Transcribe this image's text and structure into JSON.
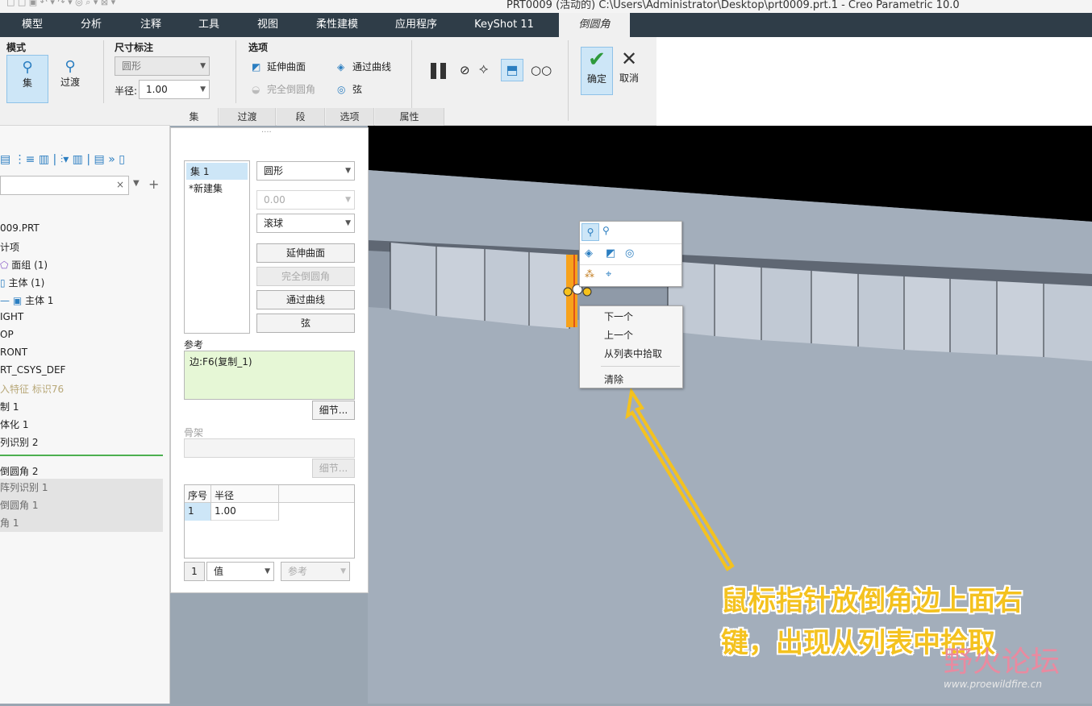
{
  "window": {
    "title": "PRT0009 (活动的) C:\\Users\\Administrator\\Desktop\\prt0009.prt.1 - Creo Parametric 10.0"
  },
  "tabs": [
    "模型",
    "分析",
    "注释",
    "工具",
    "视图",
    "柔性建模",
    "应用程序",
    "KeyShot 11",
    "倒圆角"
  ],
  "ribbon": {
    "mode": {
      "label": "模式",
      "set_label": "集",
      "transition_label": "过渡"
    },
    "dimension": {
      "label": "尺寸标注",
      "shape_value": "圆形",
      "radius_label": "半径:",
      "radius_value": "1.00"
    },
    "options": {
      "label": "选项",
      "extend_surface": "延伸曲面",
      "full_round": "完全倒圆角",
      "through_curve": "通过曲线",
      "chord": "弦"
    },
    "ok_label": "确定",
    "cancel_label": "取消"
  },
  "subtabs": [
    "集",
    "过渡",
    "段",
    "选项",
    "属性"
  ],
  "tree": {
    "rows": [
      "009.PRT",
      "计项",
      "面组 (1)",
      "主体 (1)",
      "主体 1",
      "IGHT",
      "OP",
      "RONT",
      "RT_CSYS_DEF",
      "入特征 标识76",
      "制 1",
      "体化 1",
      "列识别 2",
      "倒圆角 2",
      "阵列识别 1",
      "倒圆角 1",
      "角 1"
    ]
  },
  "panel": {
    "sets": [
      "集 1",
      "*新建集"
    ],
    "shape": "圆形",
    "value": "0.00",
    "method": "滚球",
    "btn_extend": "延伸曲面",
    "btn_full": "完全倒圆角",
    "btn_curve": "通过曲线",
    "btn_chord": "弦",
    "ref_label": "参考",
    "ref_value": "边:F6(复制_1)",
    "details": "细节...",
    "skeleton_label": "骨架",
    "skeleton_details": "细节...",
    "table_headers": [
      "序号",
      "半径"
    ],
    "table_row": [
      "1",
      "1.00"
    ],
    "bottom_num": "1",
    "bottom_value": "值",
    "bottom_ref": "参考",
    "grip": "····"
  },
  "context_menu": {
    "items": [
      "下一个",
      "上一个",
      "从列表中拾取",
      "清除"
    ]
  },
  "annotation": {
    "line1": "鼠标指针放倒角边上面右",
    "line2": "键，出现从列表中拾取"
  },
  "watermark": {
    "brand": "野火论坛",
    "url": "www.proewildfire.cn"
  },
  "colors": {
    "accent": "#2b7ec1",
    "annotation": "#f4c21f",
    "selected_edge": "#f7a21b",
    "ok_green": "#2e9a3c"
  }
}
